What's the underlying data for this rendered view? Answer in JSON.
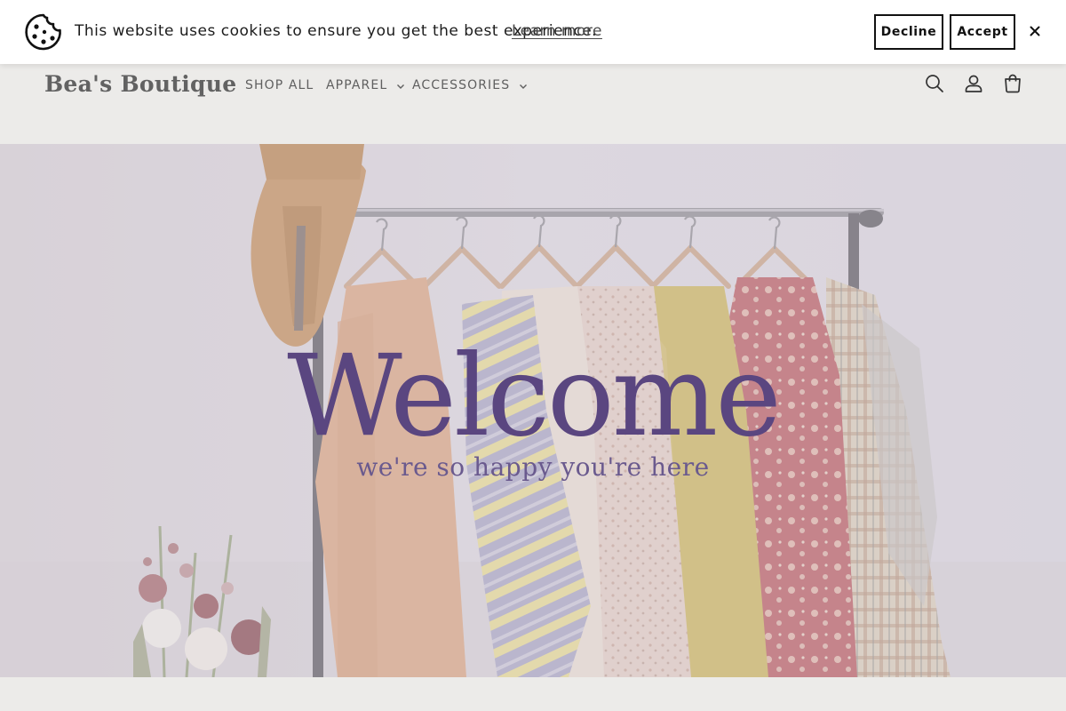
{
  "cookie_banner": {
    "message": "This website uses cookies to ensure you get the best experience.",
    "learn_more": "Learn more",
    "decline_label": "Decline",
    "accept_label": "Accept",
    "close_label": "×"
  },
  "header": {
    "logo": "Bea's Boutique",
    "nav": [
      {
        "label": "SHOP ALL"
      },
      {
        "label": "APPAREL",
        "has_dropdown": true
      },
      {
        "label": "ACCESSORIES",
        "has_dropdown": true
      }
    ],
    "icons": [
      "search-icon",
      "account-icon",
      "cart-icon"
    ]
  },
  "hero": {
    "title": "Welcome",
    "subtitle": "we're so happy you're here"
  },
  "colors": {
    "hero_text": "#5a4680",
    "logo": "#626262",
    "page_bg": "#ecebe9"
  }
}
